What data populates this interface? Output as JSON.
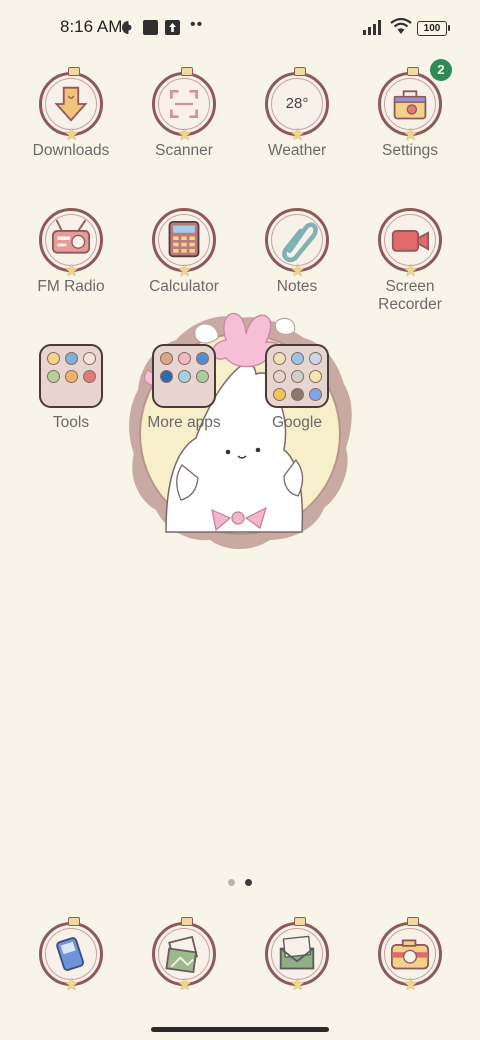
{
  "status_bar": {
    "time": "8:16 AM",
    "battery": "100"
  },
  "apps": [
    {
      "name": "downloads",
      "label": "Downloads"
    },
    {
      "name": "scanner",
      "label": "Scanner"
    },
    {
      "name": "weather",
      "label": "Weather",
      "temperature": "28°"
    },
    {
      "name": "settings",
      "label": "Settings",
      "badge": "2"
    },
    {
      "name": "fm-radio",
      "label": "FM Radio"
    },
    {
      "name": "calculator",
      "label": "Calculator"
    },
    {
      "name": "notes",
      "label": "Notes"
    },
    {
      "name": "screen-recorder",
      "label": "Screen\nRecorder"
    }
  ],
  "folders": [
    {
      "name": "tools",
      "label": "Tools"
    },
    {
      "name": "more-apps",
      "label": "More apps"
    },
    {
      "name": "google",
      "label": "Google"
    }
  ],
  "dock": [
    {
      "name": "phone",
      "icon": "phone-icon"
    },
    {
      "name": "gallery",
      "icon": "photos-icon"
    },
    {
      "name": "messages",
      "icon": "envelope-icon"
    },
    {
      "name": "camera",
      "icon": "camera-icon"
    }
  ],
  "pager": {
    "pages": 2,
    "active": 2
  },
  "colors": {
    "background": "#f8f5e8",
    "icon_ring": "#8c5a5a",
    "badge": "#2e8b57",
    "star": "#f3d58a"
  }
}
